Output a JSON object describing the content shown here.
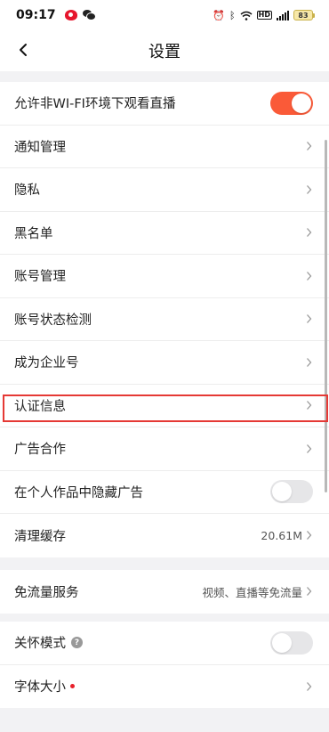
{
  "status_bar": {
    "time": "09:17",
    "battery": "83",
    "icons": [
      "weibo-icon",
      "wechat-icon",
      "alarm-icon",
      "bluetooth-icon",
      "wifi-icon",
      "hd-icon",
      "signal-icon",
      "battery-icon"
    ]
  },
  "header": {
    "title": "设置",
    "back_icon": "chevron-left-icon"
  },
  "colors": {
    "accent": "#fa5a38",
    "highlight": "#e53935",
    "dot": "#e8202a"
  },
  "group1": {
    "wifi_live": {
      "label": "允许非WI-FI环境下观看直播",
      "enabled": true
    },
    "notify": {
      "label": "通知管理"
    },
    "privacy": {
      "label": "隐私"
    },
    "blacklist": {
      "label": "黑名单"
    },
    "account": {
      "label": "账号管理"
    },
    "account_check": {
      "label": "账号状态检测"
    },
    "enterprise": {
      "label": "成为企业号"
    },
    "verify": {
      "label": "认证信息"
    },
    "ads": {
      "label": "广告合作"
    },
    "hide_ads": {
      "label": "在个人作品中隐藏广告",
      "enabled": false
    },
    "cache": {
      "label": "清理缓存",
      "value": "20.61M"
    }
  },
  "group2": {
    "free_data": {
      "label": "免流量服务",
      "value": "视频、直播等免流量"
    }
  },
  "group3": {
    "care_mode": {
      "label": "关怀模式",
      "enabled": false
    },
    "font_size": {
      "label": "字体大小"
    }
  }
}
